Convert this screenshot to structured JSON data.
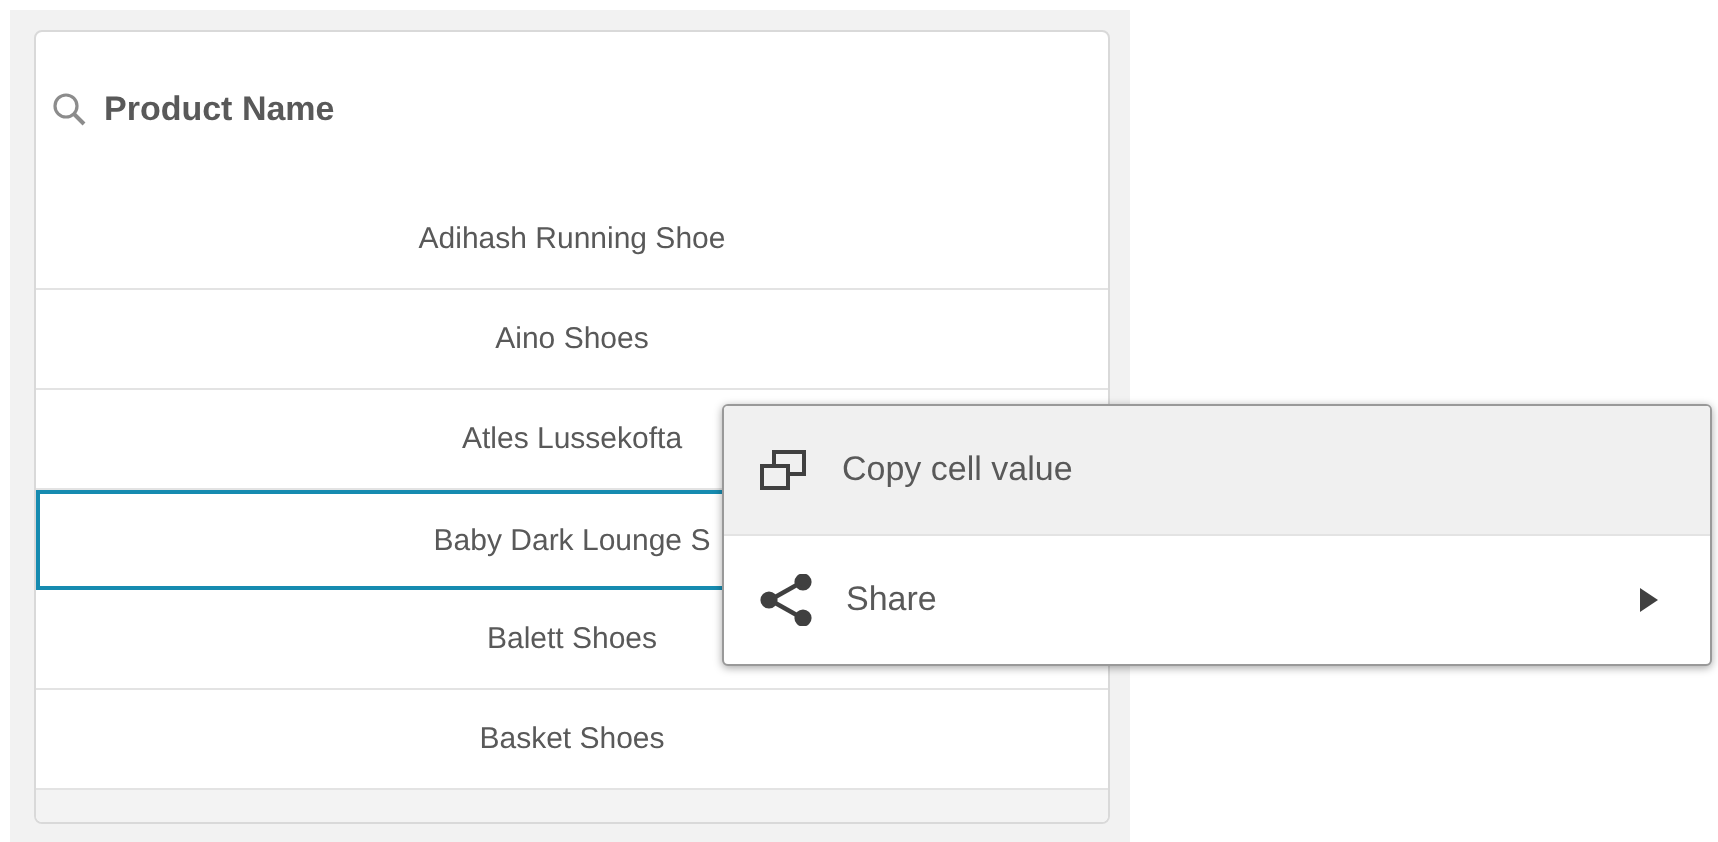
{
  "listbox": {
    "title": "Product Name",
    "rows": [
      {
        "label": "Adihash Running Shoe",
        "selected": false
      },
      {
        "label": "Aino Shoes",
        "selected": false
      },
      {
        "label": "Atles Lussekofta",
        "selected": false
      },
      {
        "label": "Baby Dark Lounge S",
        "selected": true
      },
      {
        "label": "Balett Shoes",
        "selected": false
      },
      {
        "label": "Basket Shoes",
        "selected": false
      }
    ]
  },
  "context_menu": {
    "items": [
      {
        "kind": "copy",
        "label": "Copy cell value",
        "selected": true,
        "submenu": false
      },
      {
        "kind": "share",
        "label": "Share",
        "selected": false,
        "submenu": true
      }
    ]
  }
}
